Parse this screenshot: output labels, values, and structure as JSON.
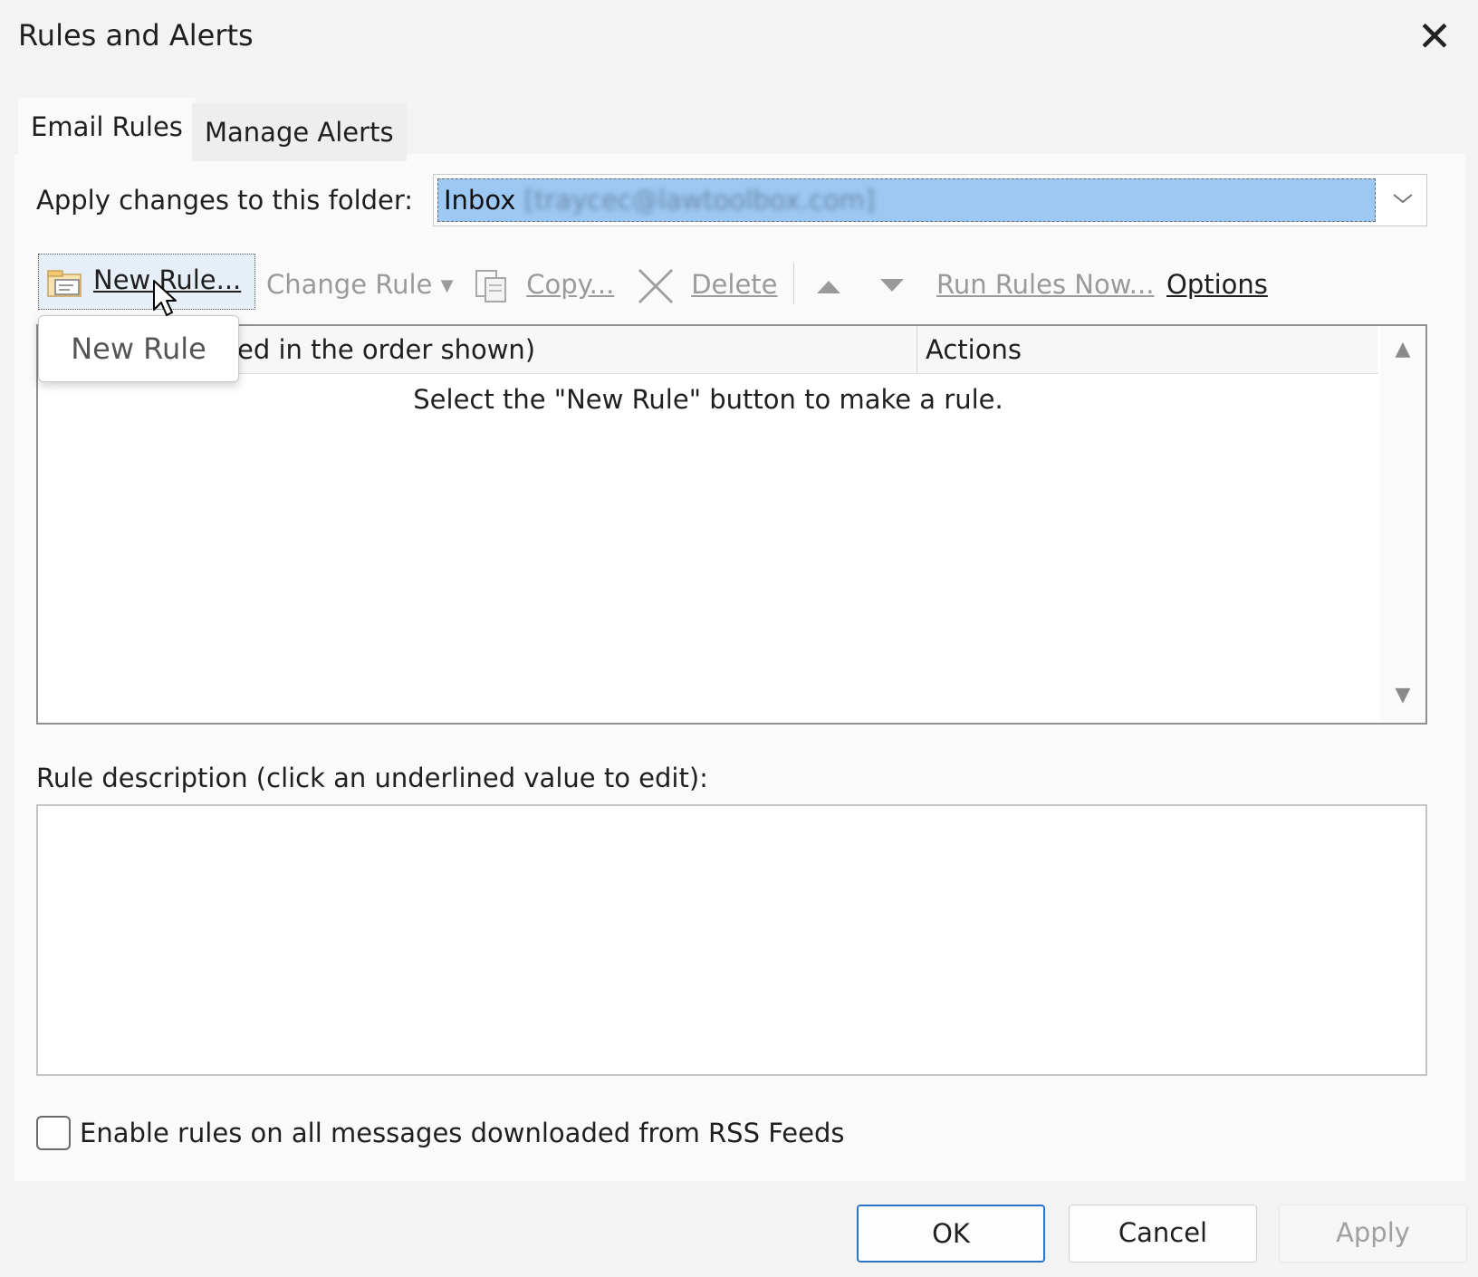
{
  "window": {
    "title": "Rules and Alerts",
    "close_glyph": "✕"
  },
  "tabs": [
    {
      "label": "Email Rules",
      "active": true
    },
    {
      "label": "Manage Alerts",
      "active": false
    }
  ],
  "folder": {
    "label": "Apply changes to this folder:",
    "value_name": "Inbox",
    "value_account": "[traycec@lawtoolbox.com]",
    "arrow_icon": "chevron-down-icon"
  },
  "toolbar": {
    "new_rule": "New Rule...",
    "change_rule": "Change Rule",
    "copy": "Copy...",
    "delete": "Delete",
    "run_rules_now": "Run Rules Now...",
    "options": "Options"
  },
  "rules_list": {
    "col_rule_visible": "ed in the order shown)",
    "col_actions": "Actions",
    "empty_message": "Select the \"New Rule\" button to make a rule."
  },
  "tooltip": {
    "text": "New Rule"
  },
  "description": {
    "label": "Rule description (click an underlined value to edit):"
  },
  "rss": {
    "label": "Enable rules on all messages downloaded from RSS Feeds",
    "checked": false
  },
  "footer": {
    "ok": "OK",
    "cancel": "Cancel",
    "apply": "Apply"
  },
  "colors": {
    "selection": "#9cc8f3",
    "ok_border": "#2b73c9",
    "disabled_text": "#9a9a9a"
  }
}
